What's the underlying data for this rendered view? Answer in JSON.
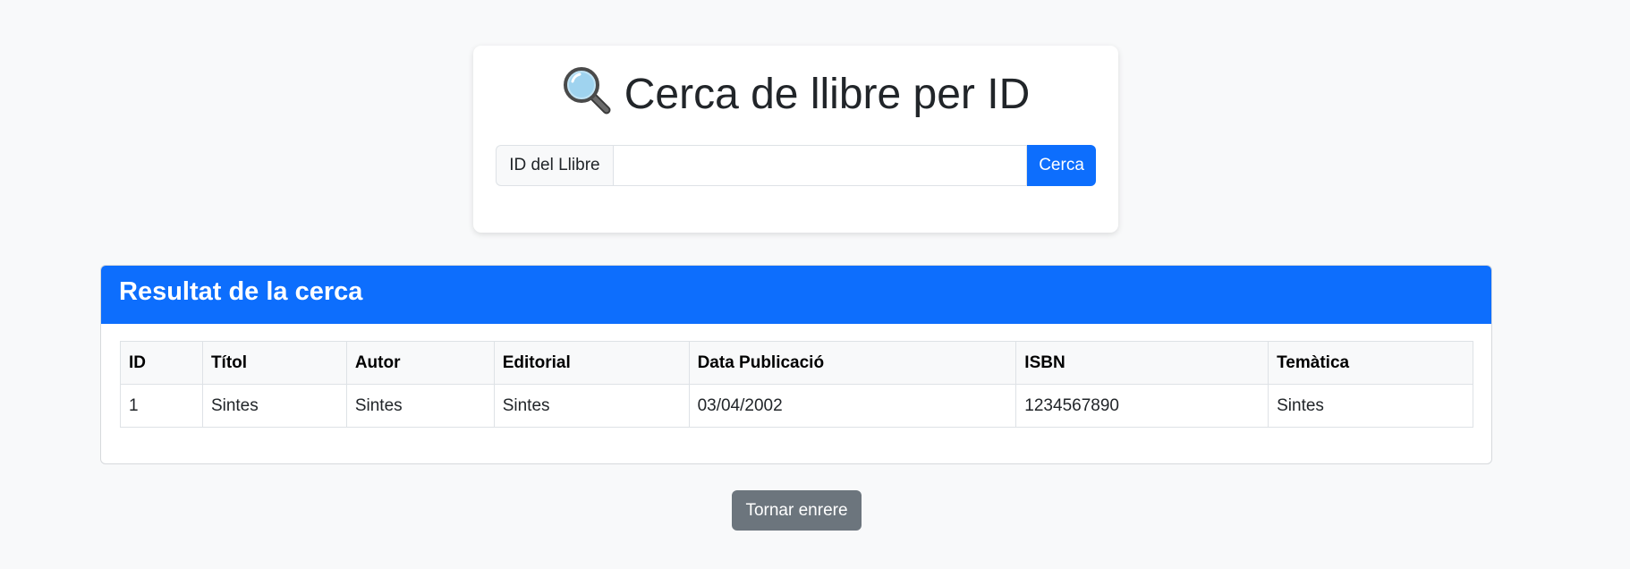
{
  "search": {
    "title": "Cerca de llibre per ID",
    "title_icon": "magnifying-glass-icon",
    "input_label": "ID del Llibre",
    "input_value": "",
    "input_placeholder": "",
    "button_label": "Cerca"
  },
  "result": {
    "header": "Resultat de la cerca",
    "columns": [
      "ID",
      "Títol",
      "Autor",
      "Editorial",
      "Data Publicació",
      "ISBN",
      "Temàtica"
    ],
    "rows": [
      [
        "1",
        "Sintes",
        "Sintes",
        "Sintes",
        "03/04/2002",
        "1234567890",
        "Sintes"
      ]
    ]
  },
  "back_button_label": "Tornar enrere",
  "colors": {
    "primary": "#0d6efd",
    "secondary": "#6c757d",
    "background": "#f8f9fa"
  }
}
